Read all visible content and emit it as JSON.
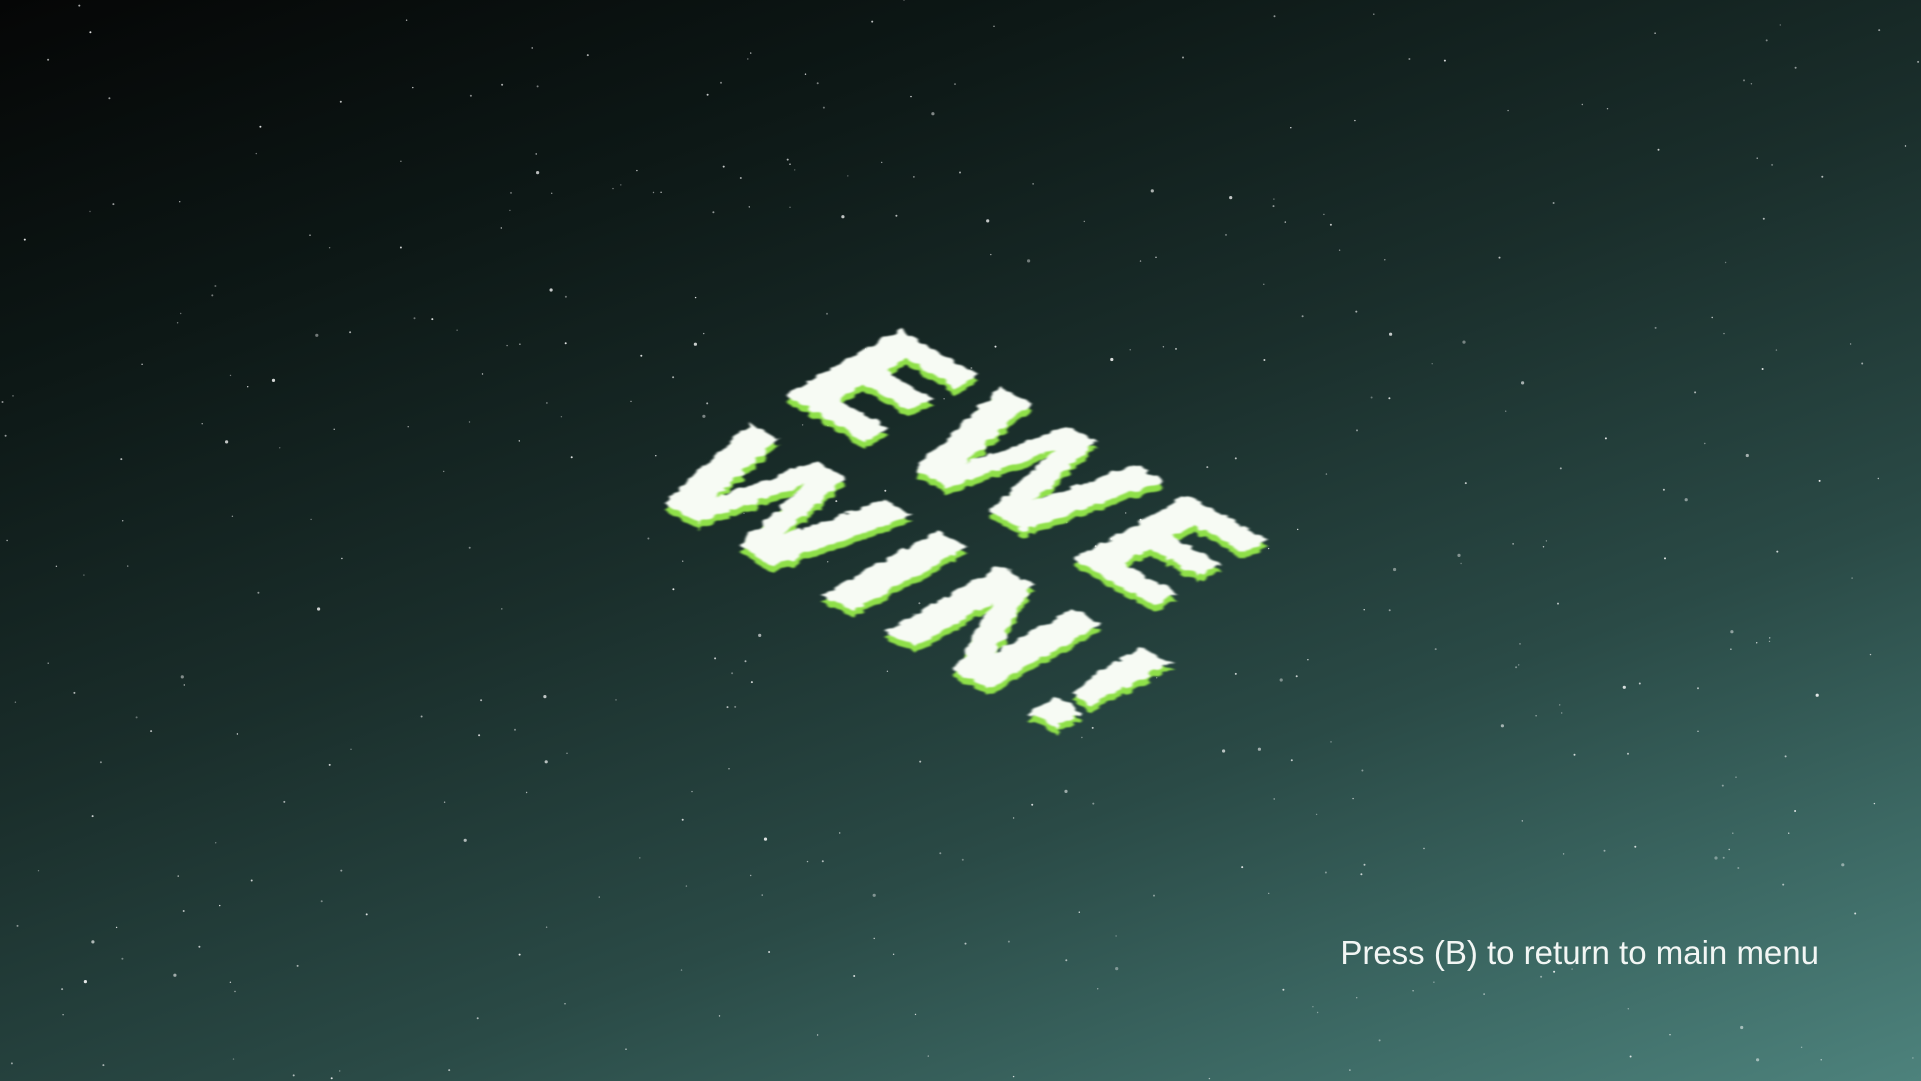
{
  "game": {
    "title_line1": "EWE",
    "title_line2": "WIN!",
    "hint": "Press (B) to return to main menu"
  },
  "colors": {
    "title_fill": "#f7fbf4",
    "title_shadow": "#8fe04a",
    "hint_text": "#f2f6f4",
    "sky_top": "#050606",
    "sky_bottom": "#4d827c"
  }
}
